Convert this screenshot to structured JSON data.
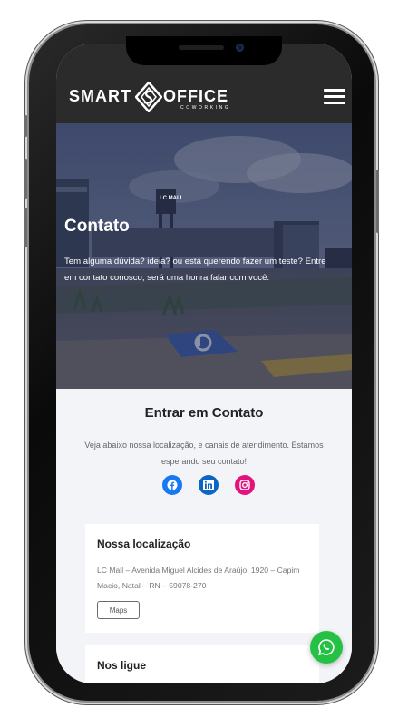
{
  "header": {
    "logo_word1": "SMART",
    "logo_word2": "OFFICE",
    "logo_sub": "COWORKING",
    "menu_icon": "hamburger-menu-icon"
  },
  "hero": {
    "title": "Contato",
    "text": "Tem alguma dúvida? ideia? ou está querendo fazer um teste? Entre em contato conosco, será uma honra falar com você.",
    "sign_text": "LC MALL"
  },
  "contact": {
    "title": "Entrar em Contato",
    "text": "Veja abaixo nossa localização, e canais de atendimento. Estamos esperando seu contato!",
    "socials": [
      {
        "name": "facebook-icon",
        "color": "#1877f2"
      },
      {
        "name": "linkedin-icon",
        "color": "#0a66c2"
      },
      {
        "name": "instagram-icon",
        "color": "#e4127c"
      }
    ]
  },
  "location_card": {
    "title": "Nossa localização",
    "address": "LC Mall – Avenida Miguel Alcides de Araújo, 1920 – Capim Macio, Natal – RN – 59078-270",
    "button_label": "Maps"
  },
  "phone_card": {
    "title": "Nos ligue"
  },
  "whatsapp": {
    "icon": "whatsapp-icon",
    "color": "#25c144"
  }
}
